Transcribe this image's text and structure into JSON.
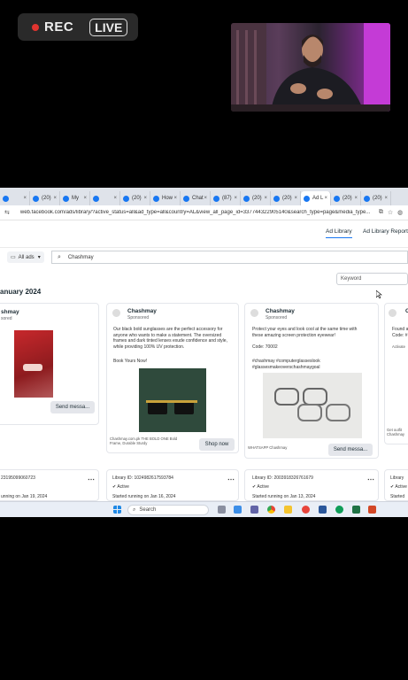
{
  "recording": {
    "rec_label": "REC",
    "live_label": "LIVE",
    "colors": {
      "dot": "#e0342f"
    }
  },
  "browser": {
    "tabs": [
      {
        "label": "",
        "icon": "globe-icon",
        "active": false
      },
      {
        "label": "(20)",
        "icon": "facebook-icon",
        "active": false
      },
      {
        "label": "My",
        "icon": "messenger-icon",
        "active": false
      },
      {
        "label": "",
        "icon": "chrome-icon",
        "active": false
      },
      {
        "label": "(20)",
        "icon": "facebook-icon",
        "active": false
      },
      {
        "label": "How",
        "icon": "page-icon",
        "active": false
      },
      {
        "label": "Chat",
        "icon": "chat-icon",
        "active": false
      },
      {
        "label": "(87)",
        "icon": "globe-icon",
        "active": false
      },
      {
        "label": "(20)",
        "icon": "facebook-icon",
        "active": false
      },
      {
        "label": "(20)",
        "icon": "facebook-icon",
        "active": false
      },
      {
        "label": "Ad L",
        "icon": "meta-icon",
        "active": true
      },
      {
        "label": "(20)",
        "icon": "facebook-icon",
        "active": false
      },
      {
        "label": "(20)",
        "icon": "facebook-icon",
        "active": false
      }
    ],
    "url": "web.facebook.com/ads/library/?active_status=all&ad_type=all&country=AL&view_all_page_id=337744322905140&search_type=page&media_type..."
  },
  "header": {
    "nav_ad_library": "Ad Library",
    "nav_report": "Ad Library Report"
  },
  "filters": {
    "all_ads": "All ads",
    "search_value": "Chashmay",
    "keyword_placeholder": "Keyword"
  },
  "date_heading": "anuary 2024",
  "cards": [
    {
      "name": "shmay",
      "sponsored": "sored",
      "button": "Send messa..."
    },
    {
      "name": "Chashmay",
      "sponsored": "Sponsored",
      "body": "Our black bold sunglasses are the perfect accessory for anyone who wants to make a statement. The oversized frames and dark tinted lenses exude confidence and style, while providing 100% UV protection.",
      "cta_text": "Book Yours Now!",
      "footer_small": "Chashmay.com.pk\nTHE BOLD ONE\nBold Frame, Durable Sturdy",
      "button": "Shop now"
    },
    {
      "name": "Chashmay",
      "sponsored": "Sponsored",
      "body": "Protect your eyes and look cool at the same time with these amazing screen protection eyewear!",
      "code": "Code: 70002",
      "tags": "#chashmay #computerglasseslook #glassesmakeoverschashmaygoal",
      "footer_small": "WHATSAPP\nChashmay",
      "button": "Send messa..."
    },
    {
      "name": "C",
      "sponsored": "",
      "body": "Found a\nCode: #",
      "footer_small": "Activate",
      "bottom_small": "Get outfit\nChashmay"
    }
  ],
  "meta_rows": [
    {
      "library_id": "23195099060723",
      "status": "",
      "started": "unning on Jan 19, 2024"
    },
    {
      "library_id": "Library ID: 1024982617593784",
      "status": "Active",
      "started": "Started running on Jan 16, 2024"
    },
    {
      "library_id": "Library ID: 2003918326761679",
      "status": "Active",
      "started": "Started running on Jan 13, 2024"
    },
    {
      "library_id": "Library",
      "status": "Active",
      "started": "Started"
    }
  ],
  "taskbar": {
    "search_label": "Search"
  }
}
